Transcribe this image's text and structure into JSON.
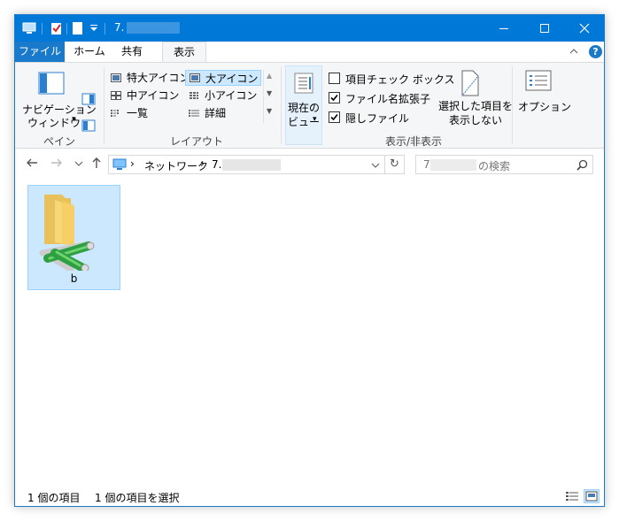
{
  "titlebar": {
    "title": "7."
  },
  "tabs": {
    "file": "ファイル",
    "home": "ホーム",
    "share": "共有",
    "view": "表示"
  },
  "ribbon": {
    "pane": {
      "nav_pane_line1": "ナビゲーション",
      "nav_pane_line2": "ウィンドウ",
      "label": "ペイン"
    },
    "layout": {
      "items": [
        "特大アイコン",
        "大アイコン",
        "中アイコン",
        "小アイコン",
        "一覧",
        "詳細"
      ],
      "selected": "大アイコン",
      "label": "レイアウト"
    },
    "current_view": {
      "line1": "現在の",
      "line2": "ビュー"
    },
    "show_hide": {
      "item_checkboxes": "項目チェック ボックス",
      "file_extensions": "ファイル名拡張子",
      "hidden_items": "隠しファイル",
      "hide_selected_line1": "選択した項目を",
      "hide_selected_line2": "表示しない",
      "label": "表示/非表示",
      "checks": {
        "item_checkboxes": false,
        "file_extensions": true,
        "hidden_items": true
      }
    },
    "options": "オプション"
  },
  "address": {
    "separator": "›",
    "network": "ネットワーク",
    "folder": "7."
  },
  "search": {
    "prefix": "7.",
    "suffix": "の検索"
  },
  "items": [
    {
      "name": "b"
    }
  ],
  "status": {
    "count": "1 個の項目",
    "selected": "1 個の項目を選択"
  },
  "colors": {
    "accent": "#0078d7",
    "selection": "#cce8ff",
    "selection_border": "#99d1ff"
  }
}
